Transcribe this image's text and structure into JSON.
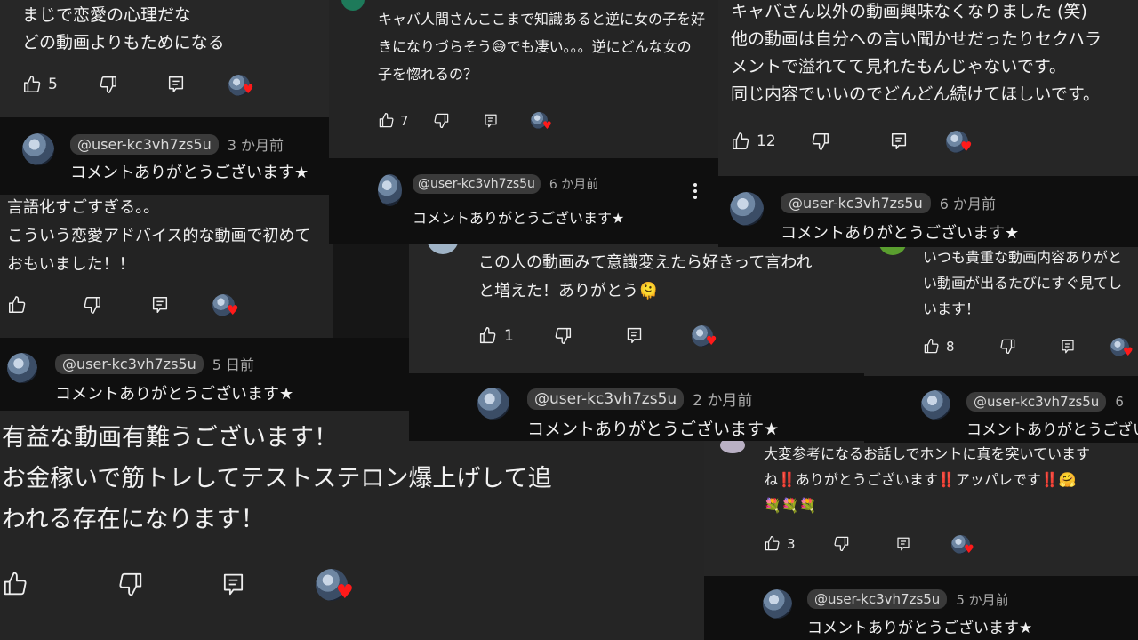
{
  "reply_text": "コメントありがとうございます★",
  "handle": "@user-kc3vh7zs5u",
  "comments": [
    {
      "text": "まじで恋愛の心理だな\nどの動画よりもためになる",
      "likes": "5"
    },
    {
      "text": "キャバ人間さんここまで知識あると逆に女の子を好\nきになりづらそう😅でも凄い。。。逆にどんな女の\n子を惚れるの？",
      "likes": "7"
    },
    {
      "text": "キャバさん以外の動画興味なくなりました (笑)\n他の動画は自分への言い聞かせだったりセクハラ\nメントで溢れてて見れたもんじゃないです。\n同じ内容でいいのでどんどん続けてほしいです。",
      "likes": "12"
    },
    {
      "text": "言語化すごすぎる。。\nこういう恋愛アドバイス的な動画で初めて\nおもいました！！",
      "likes": ""
    },
    {
      "text": "この人の動画みて意識変えたら好きって言われ\nと増えた！ありがとう🫠",
      "likes": "1"
    },
    {
      "text": "いつも貴重な動画内容ありがと\nい動画が出るたびにすぐ見てし\nいます！",
      "likes": "8"
    },
    {
      "text": "有益な動画有難うございます！\nお金稼いで筋トレしてテストステロン爆上げして追\nわれる存在になります！",
      "likes": ""
    },
    {
      "text": "大変参考になるお話しでホントに真を突いています\nね‼️ありがとうございます‼️アッパレです‼️🤗\n💐💐💐",
      "likes": "3"
    }
  ],
  "replies": [
    {
      "time": "3 か月前"
    },
    {
      "time": "6 か月前"
    },
    {
      "time": "6 か月前"
    },
    {
      "time": "5 日前"
    },
    {
      "time": "2 か月前"
    },
    {
      "time": "6"
    },
    {
      "time": "5 か月前"
    }
  ]
}
